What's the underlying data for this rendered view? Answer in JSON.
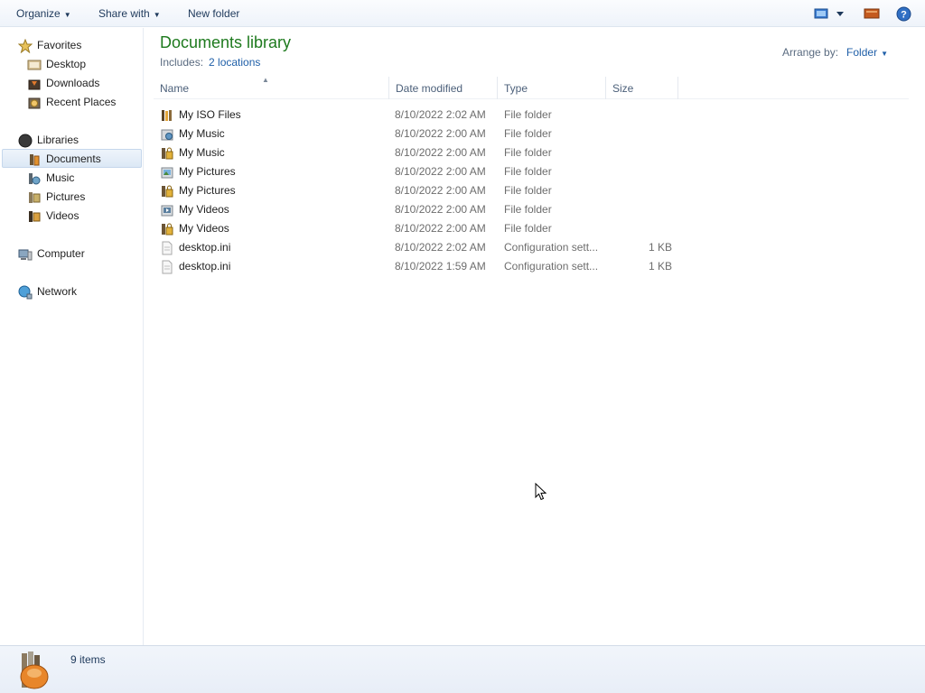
{
  "toolbar": {
    "organize": "Organize",
    "share_with": "Share with",
    "new_folder": "New folder"
  },
  "nav": {
    "favorites": {
      "label": "Favorites",
      "icon": "star-icon"
    },
    "favorites_items": [
      {
        "label": "Desktop",
        "icon": "desktop-icon"
      },
      {
        "label": "Downloads",
        "icon": "downloads-icon"
      },
      {
        "label": "Recent Places",
        "icon": "recent-places-icon"
      }
    ],
    "libraries": {
      "label": "Libraries",
      "icon": "libraries-icon"
    },
    "libraries_items": [
      {
        "label": "Documents",
        "icon": "documents-library-icon",
        "selected": true
      },
      {
        "label": "Music",
        "icon": "music-library-icon"
      },
      {
        "label": "Pictures",
        "icon": "pictures-library-icon"
      },
      {
        "label": "Videos",
        "icon": "videos-library-icon"
      }
    ],
    "computer": {
      "label": "Computer",
      "icon": "computer-icon"
    },
    "network": {
      "label": "Network",
      "icon": "network-icon"
    }
  },
  "library": {
    "title": "Documents library",
    "includes_label": "Includes:",
    "includes_link": "2 locations",
    "arrange_label": "Arrange by:",
    "arrange_value": "Folder"
  },
  "columns": {
    "name": "Name",
    "date": "Date modified",
    "type": "Type",
    "size": "Size"
  },
  "files": [
    {
      "name": "My ISO Files",
      "date": "8/10/2022 2:02 AM",
      "type": "File folder",
      "size": "",
      "icon": "folder-icon"
    },
    {
      "name": "My Music",
      "date": "8/10/2022 2:00 AM",
      "type": "File folder",
      "size": "",
      "icon": "music-folder-icon"
    },
    {
      "name": "My Music",
      "date": "8/10/2022 2:00 AM",
      "type": "File folder",
      "size": "",
      "icon": "locked-folder-icon"
    },
    {
      "name": "My Pictures",
      "date": "8/10/2022 2:00 AM",
      "type": "File folder",
      "size": "",
      "icon": "pictures-folder-icon"
    },
    {
      "name": "My Pictures",
      "date": "8/10/2022 2:00 AM",
      "type": "File folder",
      "size": "",
      "icon": "locked-folder-icon"
    },
    {
      "name": "My Videos",
      "date": "8/10/2022 2:00 AM",
      "type": "File folder",
      "size": "",
      "icon": "videos-folder-icon"
    },
    {
      "name": "My Videos",
      "date": "8/10/2022 2:00 AM",
      "type": "File folder",
      "size": "",
      "icon": "locked-folder-icon"
    },
    {
      "name": "desktop.ini",
      "date": "8/10/2022 2:02 AM",
      "type": "Configuration sett...",
      "size": "1 KB",
      "icon": "config-file-icon"
    },
    {
      "name": "desktop.ini",
      "date": "8/10/2022 1:59 AM",
      "type": "Configuration sett...",
      "size": "1 KB",
      "icon": "config-file-icon"
    }
  ],
  "status": {
    "count": "9 items"
  }
}
